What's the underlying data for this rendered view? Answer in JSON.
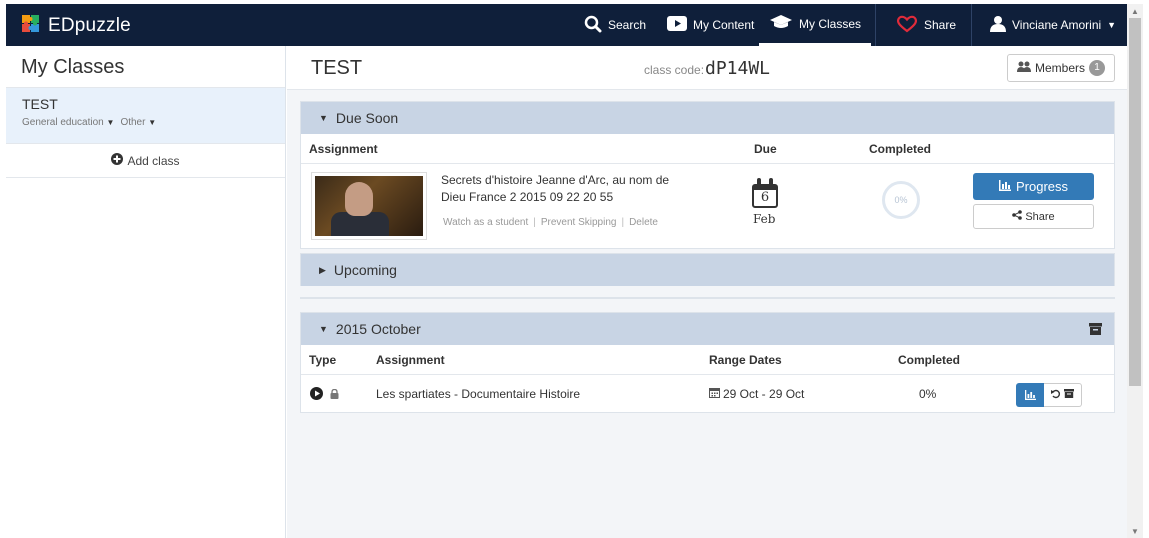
{
  "nav": {
    "brand": "EDpuzzle",
    "search": "Search",
    "my_content": "My Content",
    "my_classes": "My Classes",
    "share": "Share",
    "user": "Vinciane Amorini"
  },
  "sidebar": {
    "title": "My Classes",
    "classes": [
      {
        "name": "TEST",
        "tag1": "General education",
        "tag2": "Other"
      }
    ],
    "add_class": "Add class"
  },
  "header": {
    "class_title": "TEST",
    "class_code_label": "class code:",
    "class_code": "dP14WL",
    "members_label": "Members",
    "members_count": "1"
  },
  "due_soon": {
    "title": "Due Soon",
    "columns": {
      "assignment": "Assignment",
      "due": "Due",
      "completed": "Completed"
    },
    "item": {
      "title": "Secrets d'histoire Jeanne d'Arc, au nom de Dieu France 2 2015 09 22 20 55",
      "link_watch": "Watch as a student",
      "link_prevent": "Prevent Skipping",
      "link_delete": "Delete",
      "due_day": "6",
      "due_month": "Feb",
      "completed": "0%",
      "progress_label": "Progress",
      "share_label": "Share"
    }
  },
  "upcoming": {
    "title": "Upcoming"
  },
  "october": {
    "title": "2015 October",
    "columns": {
      "type": "Type",
      "assignment": "Assignment",
      "range": "Range Dates",
      "completed": "Completed"
    },
    "rows": [
      {
        "assignment": "Les spartiates - Documentaire Histoire",
        "range": "29 Oct - 29 Oct",
        "completed": "0%"
      }
    ]
  },
  "colors": {
    "nav_bg": "#0f1f3a",
    "panel_header": "#c8d4e4",
    "primary": "#337ab7",
    "sidebar_selected": "#e8f1fb"
  }
}
